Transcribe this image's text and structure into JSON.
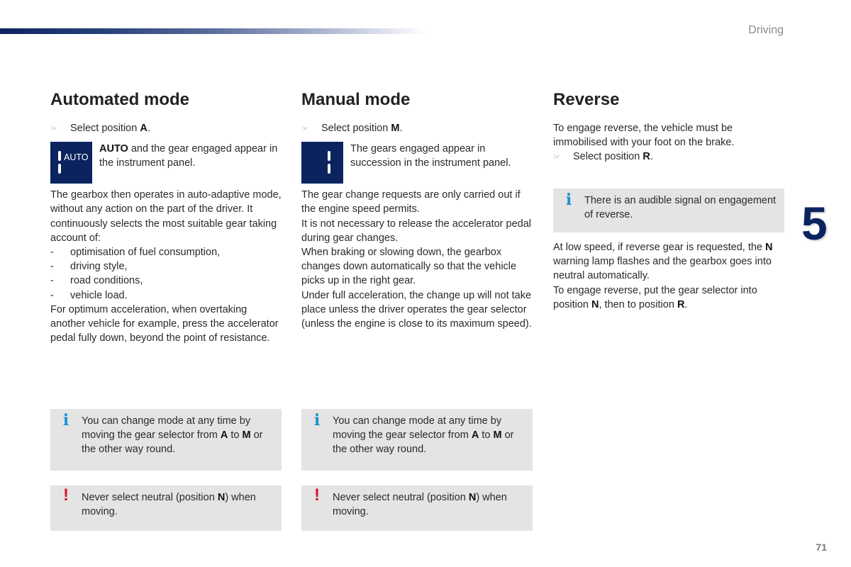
{
  "header": {
    "chapter_title": "Driving",
    "chapter_number": "5",
    "page_number": "71"
  },
  "icons": {
    "bullet": "☞",
    "info": "i",
    "warning": "!"
  },
  "colors": {
    "brand_navy": "#0b2460",
    "info_blue": "#1f8fd0",
    "warning_red": "#d4172b",
    "note_bg": "#e4e4e4"
  },
  "automated": {
    "title": "Automated mode",
    "step_prefix": "Select position ",
    "step_bold": "A",
    "step_suffix": ".",
    "icon_label": "AUTO",
    "icon_text_bold": "AUTO",
    "icon_text_rest": " and the gear engaged appear in the instrument panel.",
    "intro": "The gearbox then operates in auto-adaptive mode, without any action on the part of the driver. It continuously selects the most suitable gear taking account of:",
    "list": [
      "optimisation of fuel consumption,",
      "driving style,",
      "road conditions,",
      "vehicle load."
    ],
    "outro": "For optimum acceleration, when overtaking another vehicle for example, press the accelerator pedal fully down, beyond the point of resistance.",
    "info_note": {
      "p1": "You can change mode at any time by moving the gear selector from ",
      "b1": "A",
      "p2": " to ",
      "b2": "M",
      "p3": " or the other way round."
    },
    "warning_note": {
      "p1": "Never select neutral (position ",
      "b1": "N",
      "p2": ") when moving."
    }
  },
  "manual": {
    "title": "Manual mode",
    "step_prefix": "Select position ",
    "step_bold": "M",
    "step_suffix": ".",
    "icon_text": "The gears engaged appear in succession in the instrument panel.",
    "paragraphs": [
      "The gear change requests are only carried out if the engine speed permits.",
      "It is not necessary to release the accelerator pedal during gear changes.",
      "When braking or slowing down, the gearbox changes down automatically so that the vehicle picks up in the right gear.",
      "Under full acceleration, the change up will not take place unless the driver operates the gear selector (unless the engine is close to its maximum speed)."
    ],
    "info_note": {
      "p1": "You can change mode at any time by moving the gear selector from ",
      "b1": "A",
      "p2": " to ",
      "b2": "M",
      "p3": " or the other way round."
    },
    "warning_note": {
      "p1": "Never select neutral (position ",
      "b1": "N",
      "p2": ") when moving."
    }
  },
  "reverse": {
    "title": "Reverse",
    "intro": "To engage reverse, the vehicle must be immobilised with your foot on the brake.",
    "step_prefix": "Select position ",
    "step_bold": "R",
    "step_suffix": ".",
    "info_note": "There is an audible signal on engagement of reverse.",
    "p1_a": "At low speed, if reverse gear is requested, the ",
    "p1_b": "N",
    "p1_c": " warning lamp flashes and the gearbox goes into neutral automatically.",
    "p2_a": "To engage reverse, put the gear selector into position ",
    "p2_b": "N",
    "p2_c": ", then to position ",
    "p2_d": "R",
    "p2_e": "."
  }
}
